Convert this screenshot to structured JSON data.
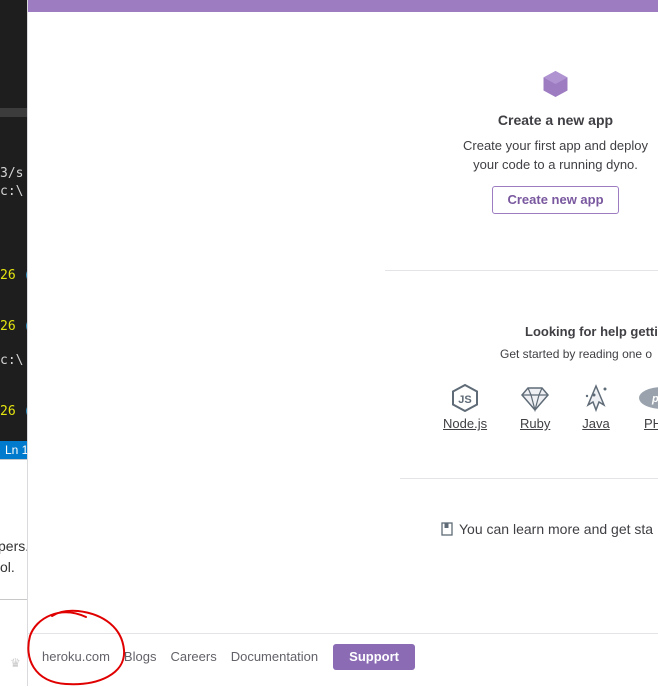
{
  "background": {
    "code_lines": [
      {
        "text": "3/s"
      },
      {
        "text": "c:\\"
      },
      {
        "text": "26",
        "tail": " (I"
      },
      {
        "text": "26",
        "tail": " (I"
      },
      {
        "text": "c:\\"
      },
      {
        "text": "26",
        "tail": " (I"
      }
    ],
    "status_bar": "Ln 1",
    "doc_lines": [
      "pers.",
      "ol."
    ]
  },
  "create_app": {
    "title": "Create a new app",
    "description_line1": "Create your first app and deploy",
    "description_line2": "your code to a running dyno.",
    "button": "Create new app"
  },
  "help": {
    "title": "Looking for help getti",
    "subtitle": "Get started by reading one o",
    "languages": [
      {
        "label": "Node.js",
        "icon": "nodejs-icon"
      },
      {
        "label": "Ruby",
        "icon": "ruby-icon"
      },
      {
        "label": "Java",
        "icon": "java-icon"
      },
      {
        "label": "PH",
        "icon": "php-icon"
      }
    ]
  },
  "learn_more": "You can learn more and get sta",
  "footer": {
    "links": [
      "heroku.com",
      "Blogs",
      "Careers",
      "Documentation"
    ],
    "support": "Support"
  },
  "colors": {
    "accent": "#9e7cc1",
    "support_button": "#8a6bb4",
    "annotation_circle": "#e00000"
  }
}
